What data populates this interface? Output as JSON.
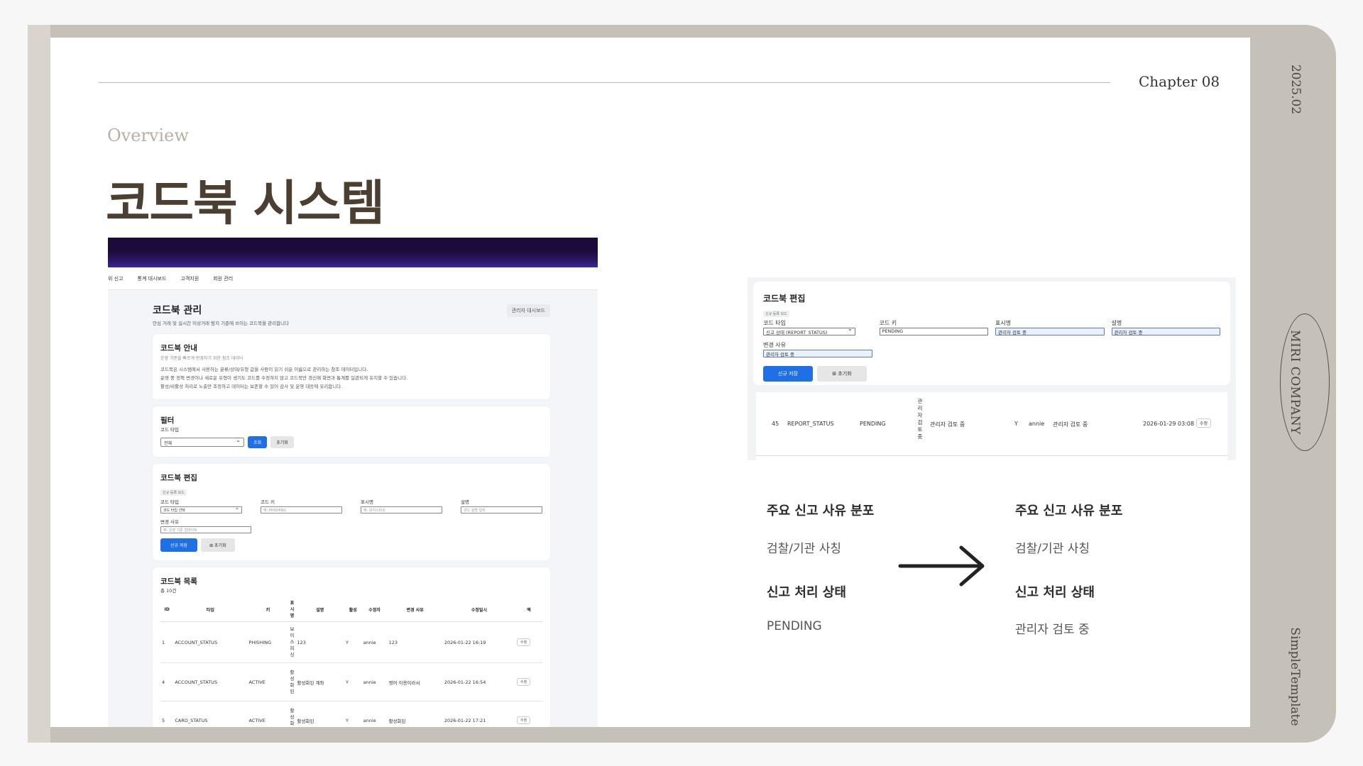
{
  "slide": {
    "chapter": "Chapter 08",
    "date": "2025.02",
    "company": "MIRI COMPANY",
    "template": "SimpleTemplate",
    "overview": "Overview",
    "title": "코드북 시스템"
  },
  "left_screenshot": {
    "nav": [
      "위 신고",
      "통계 대시보드",
      "고객지원",
      "회원 관리"
    ],
    "page_title": "코드북 관리",
    "page_subtitle": "안심 거래 및 실시간 이상거래 탐지 기준에 쓰이는 코드북을 관리합니다",
    "admin_button": "관리자 대시보드",
    "guide": {
      "title": "코드북 안내",
      "subtitle": "운영 기준을 빠르게 반영하기 위한 참조 데이터",
      "line1": "코드북은 시스템에서 사용하는 분류/상태/유형 값을 사람이 읽기 쉬운 이름으로 관리하는 참조 데이터입니다.",
      "line2": "운영 중 정책 변경이나 새로운 유형이 생기도 코드를 수정하지 않고 코드북만 갱신해 화면과 통계를 일관되게 유지할 수 있습니다.",
      "line3": "활성/비활성 처리로 노출만 조정하고 데이터는 보존할 수 있어 감사 및 운영 대응에 유리합니다."
    },
    "filter": {
      "title": "필터",
      "label": "코드 타입",
      "select_value": "전체",
      "search_button": "조회",
      "reset_button": "초기화"
    },
    "edit": {
      "title": "코드북 편집",
      "mode_chip": "신규 등록 모드",
      "type_label": "코드 타입",
      "type_value": "코드 타입 선택",
      "key_label": "코드 키",
      "key_placeholder": "예: PHISHING",
      "display_label": "표시명",
      "display_placeholder": "예: 보이스피싱",
      "desc_label": "설명",
      "desc_placeholder": "코드 설명 입력",
      "reason_label": "변경 사유",
      "reason_placeholder": "예: 운영 기준 업데이트",
      "save_button": "신규 저장",
      "reset_button": "⊞ 초기화"
    },
    "list": {
      "title": "코드북 목록",
      "count": "총 10건",
      "headers": [
        "ID",
        "타입",
        "키",
        "표시명",
        "설명",
        "활성",
        "수정자",
        "변경 사유",
        "수정일시",
        "액"
      ],
      "rows": [
        {
          "id": "1",
          "type": "ACCOUNT_STATUS",
          "key": "PHISHING",
          "display": "보이스피싱",
          "desc": "123",
          "active": "Y",
          "editor": "annie",
          "reason": "123",
          "date": "2026-01-22 16:19",
          "action": "수정"
        },
        {
          "id": "4",
          "type": "ACCOUNT_STATUS",
          "key": "ACTIVE",
          "display": "활성화된",
          "desc": "활성화된 계좌",
          "active": "Y",
          "editor": "annie",
          "reason": "영어 이용이라서",
          "date": "2026-01-22 16:54",
          "action": "수정"
        },
        {
          "id": "5",
          "type": "CARD_STATUS",
          "key": "ACTIVE",
          "display": "활성화된",
          "desc": "활성화된",
          "active": "Y",
          "editor": "annie",
          "reason": "활성화된",
          "date": "2026-01-22 17:21",
          "action": "수정"
        }
      ]
    }
  },
  "right_screenshot": {
    "title": "코드북 편집",
    "mode_chip": "신규 등록 모드",
    "type_label": "코드 타입",
    "type_value": "신고 상태 (REPORT_STATUS)",
    "key_label": "코드 키",
    "key_value": "PENDING",
    "display_label": "표시명",
    "display_value": "관리자 검토 중",
    "desc_label": "설명",
    "desc_value": "관리자 검토 중",
    "reason_label": "변경 사유",
    "reason_value": "관리자 검토 중",
    "save_button": "신규 저장",
    "reset_button": "⊞ 초기화",
    "row": {
      "id": "45",
      "type": "REPORT_STATUS",
      "key": "PENDING",
      "display": "관리자검토중",
      "desc": "관리자 검토 중",
      "active": "Y",
      "editor": "annie",
      "reason": "관리자 검토 중",
      "date": "2026-01-29 03:08",
      "action": "수정"
    }
  },
  "comparison": {
    "before": {
      "head1": "주요 신고 사유 분포",
      "val1": "검찰/기관 사칭",
      "head2": "신고 처리 상태",
      "val2": "PENDING"
    },
    "after": {
      "head1": "주요 신고 사유 분포",
      "val1": "검찰/기관 사칭",
      "head2": "신고 처리 상태",
      "val2": "관리자 검토 중"
    }
  }
}
